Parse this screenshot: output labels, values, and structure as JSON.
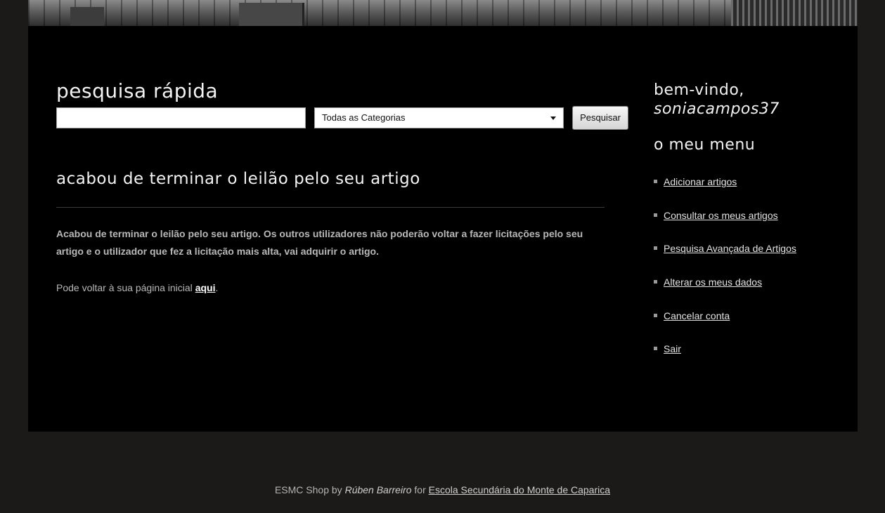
{
  "search": {
    "title": "pesquisa rápida",
    "input_value": "",
    "category_selected": "Todas as Categorias",
    "button_label": "Pesquisar"
  },
  "main": {
    "title": "acabou de terminar o leilão pelo seu artigo",
    "message": "Acabou de terminar o leilão pelo seu artigo. Os outros utilizadores não poderão voltar a fazer licitações pelo seu artigo e o utilizador que fez a licitação mais alta, vai adquirir o artigo.",
    "back_text": "Pode voltar à sua página inicial ",
    "back_link": "aqui",
    "back_end": "."
  },
  "sidebar": {
    "welcome": "bem-vindo,",
    "username": "soniacampos37",
    "menu_title": "o meu menu",
    "items": [
      {
        "label": "Adicionar artigos"
      },
      {
        "label": "Consultar os meus artigos"
      },
      {
        "label": "Pesquisa Avançada de Artigos"
      },
      {
        "label": "Alterar os meus dados"
      },
      {
        "label": "Cancelar conta"
      },
      {
        "label": "Sair"
      }
    ]
  },
  "footer": {
    "prefix": "ESMC Shop by ",
    "author": "Rúben Barreiro",
    "middle": " for ",
    "school": "Escola Secundária do Monte de Caparica"
  },
  "colors": {
    "page_bg": "#1b1a18",
    "panel_bg": "#000000",
    "heading": "#f2f2f2",
    "text": "#b8b8b8"
  }
}
